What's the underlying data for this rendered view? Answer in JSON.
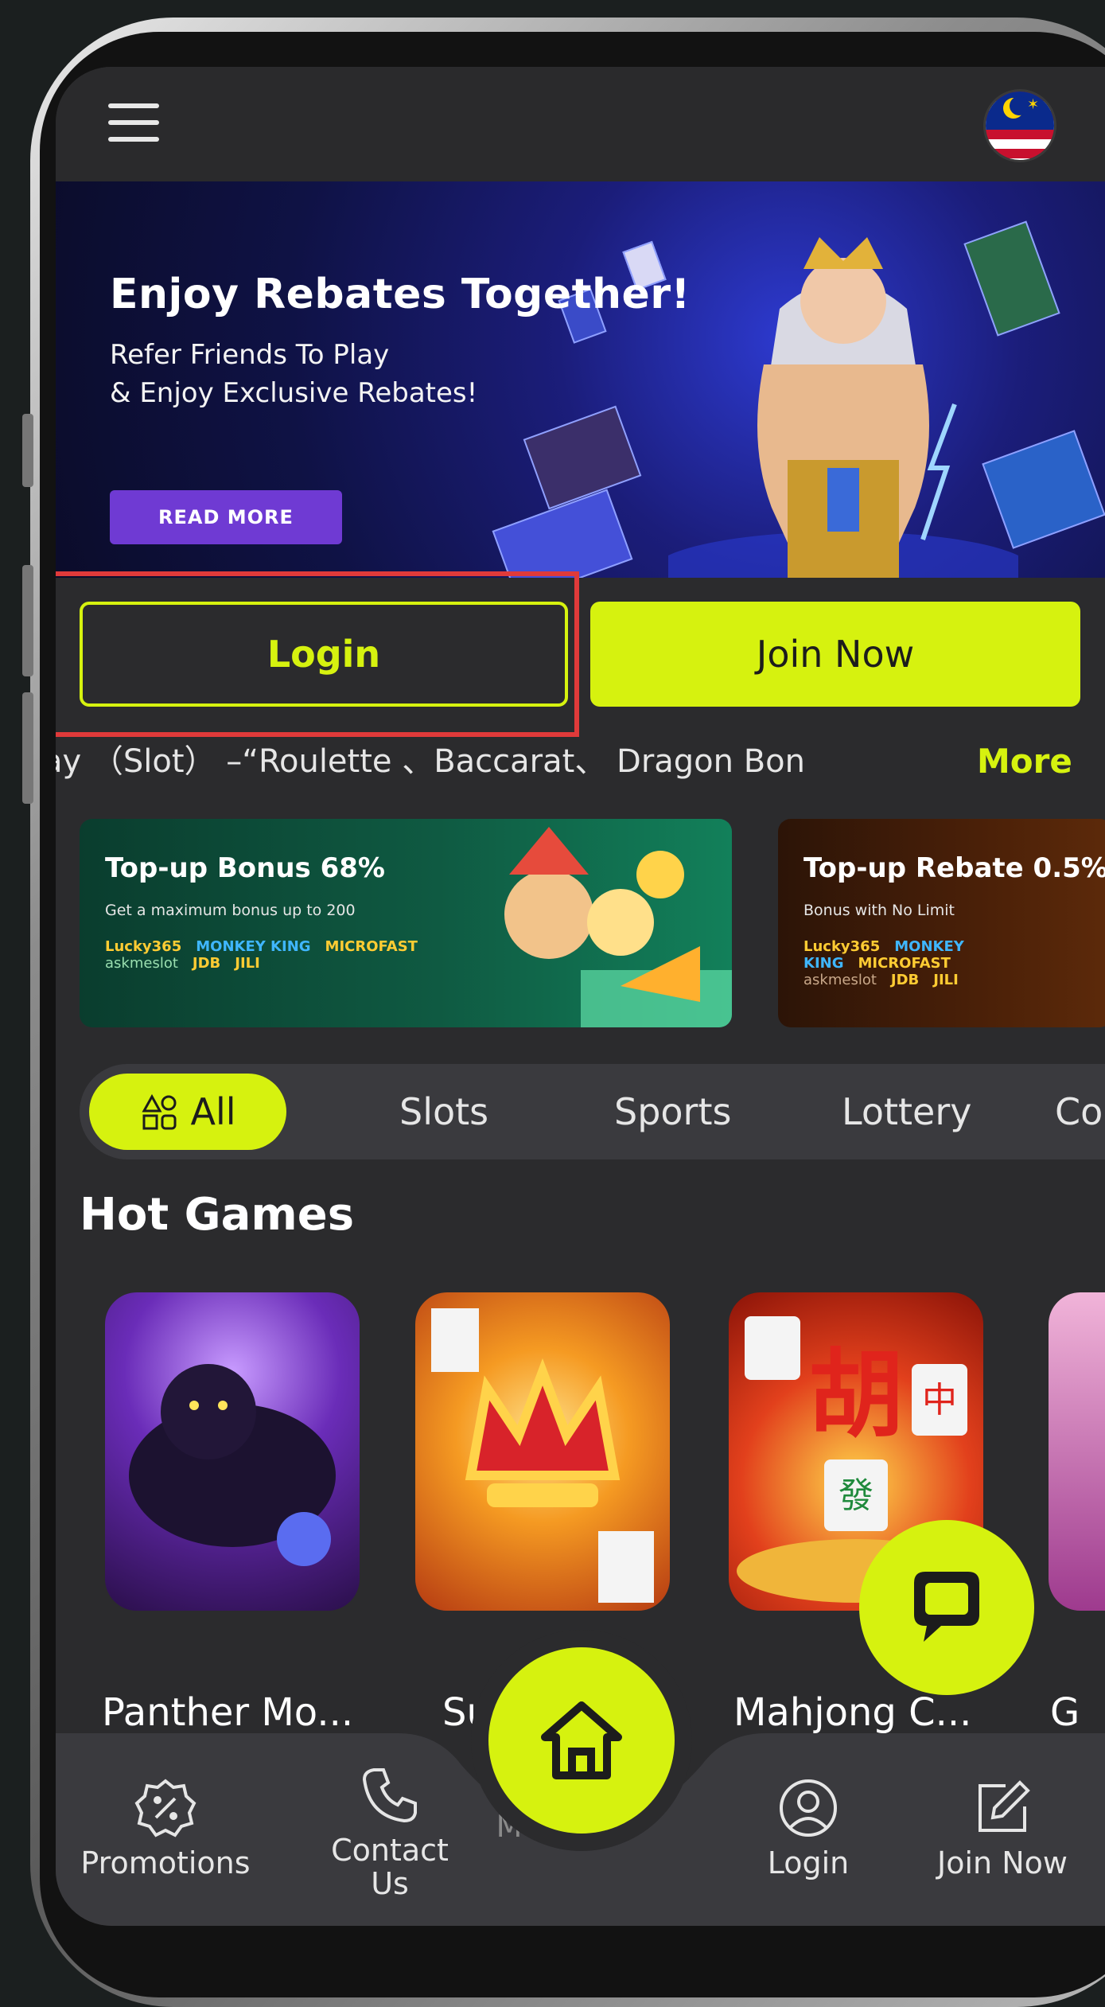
{
  "banner": {
    "title": "Enjoy Rebates Together!",
    "subtitle_line1": "Refer Friends To Play",
    "subtitle_line2": "& Enjoy Exclusive Rebates!",
    "button_label": "READ MORE"
  },
  "auth": {
    "login_label": "Login",
    "join_label": "Join Now"
  },
  "marquee": {
    "text": "ay （Slot） –“Roulette 、Baccarat、 Dragon Bon",
    "more_label": "More"
  },
  "promos": [
    {
      "title": "Top-up Bonus 68%",
      "subtitle": "Get a maximum bonus up to 200",
      "logos": [
        "Lucky365",
        "MONKEY KING",
        "MICROFAST",
        "askmeslot",
        "JDB",
        "JILI"
      ]
    },
    {
      "title": "Top-up Rebate 0.5%",
      "subtitle": "Bonus with No Limit",
      "logos": [
        "Lucky365",
        "MONKEY KING",
        "MICROFAST",
        "askmeslot",
        "JDB",
        "JILI"
      ]
    }
  ],
  "tabs": [
    "All",
    "Slots",
    "Sports",
    "Lottery",
    "Co"
  ],
  "hot_games": {
    "title": "Hot Games",
    "games": [
      "Panther Mo...",
      "Su",
      "Mahjong C...",
      "G"
    ]
  },
  "bottom_nav": {
    "promotions": "Promotions",
    "contact_line1": "Contact",
    "contact_line2": "Us",
    "login": "Login",
    "join": "Join Now",
    "partial_under_home": "M"
  },
  "colors": {
    "accent": "#d6f20f",
    "surface": "#2b2b2d",
    "highlight": "#e03a3a",
    "banner_button": "#6f3ad3"
  }
}
